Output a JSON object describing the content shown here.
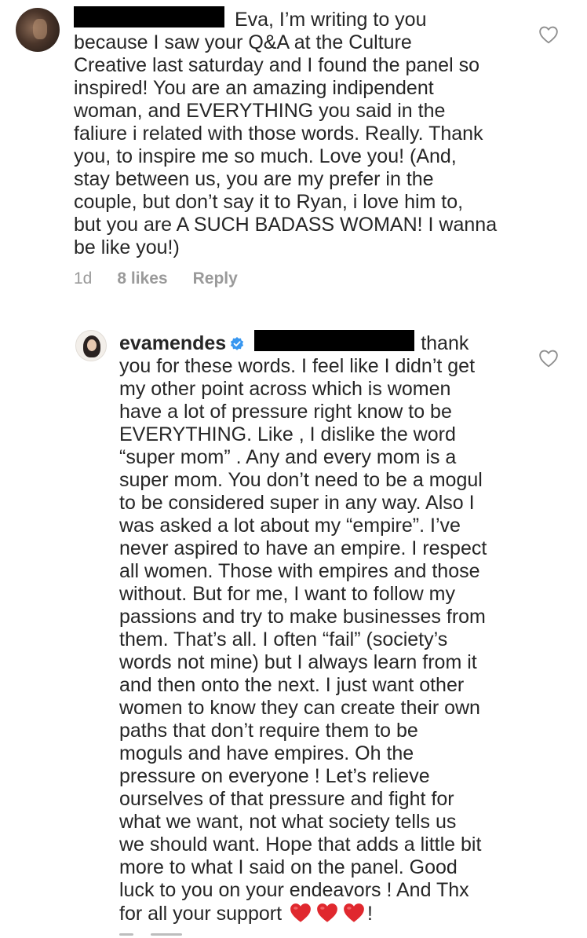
{
  "comment1": {
    "text_after_redaction": " Eva, I’m writing to you\nbecause I saw your Q&A at the Culture\nCreative last saturday and I found the panel so\ninspired! You are an amazing indipendent\nwoman, and EVERYTHING you said in the\nfaliure i related with those words. Really. Thank\nyou, to inspire me so much. Love you! (And,\nstay between us, you are my prefer in the\ncouple, but don’t say it to Ryan, i love him to,\nbut you are A SUCH BADASS WOMAN! I wanna\nbe like you!)",
    "time": "1d",
    "likes": "8 likes",
    "reply": "Reply"
  },
  "reply1": {
    "username": "evamendes",
    "text_after_redaction": "thank\nyou for these words. I feel like I didn’t get\nmy other point across which is women\nhave a lot of pressure right know to be\nEVERYTHING. Like , I dislike the word\n“super mom” . Any and every mom is a\nsuper mom. You don’t need to be a mogul\nto be considered super in any way. Also I\nwas asked a lot about my “empire”. I’ve\nnever aspired to have an empire. I respect\nall women. Those with empires and those\nwithout. But for me, I want to follow my\npassions and try to make businesses from\nthem. That’s all. I often “fail” (society’s\nwords not mine) but I always learn from it\nand then onto the next. I just want other\nwomen to know they can create their own\npaths that don’t require them to be\nmoguls and have empires. Oh the\npressure on everyone ! Let’s relieve\nourselves of that pressure and fight for\nwhat we want, not what society tells us\nwe should want. Hope that adds a little bit\nmore to what I said on the panel. Good\nluck to you on your endeavors ! And Thx\nfor all your support",
    "ending": "!"
  },
  "icons": {
    "like": "heart-outline-icon",
    "verified": "verified-badge-icon",
    "emoji": "red-heart-emoji-icon"
  },
  "colors": {
    "text": "#262626",
    "meta": "#9a9a9a",
    "verified": "#3897f0",
    "heart_emoji": "#e0282e",
    "redaction": "#000000"
  }
}
